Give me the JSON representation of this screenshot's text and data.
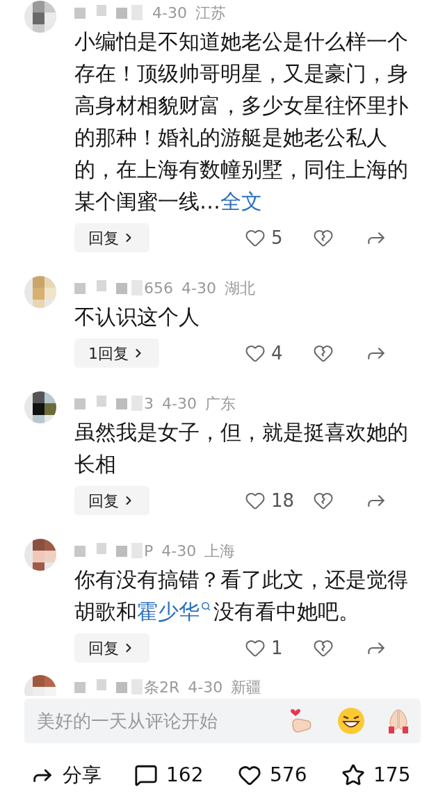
{
  "comments": [
    {
      "date": "4-30",
      "location": "江苏",
      "body": [
        {
          "kind": "text",
          "text": "小编怕是不知道她老公是什么样一个存在！顶级帅哥明星，又是豪门，身高身材相貌财富，多少女星往怀里扑的那种！婚礼的游艇是她老公私人的，在上海有数幢别墅，同住上海的某个闺蜜一线…"
        },
        {
          "kind": "link",
          "text": "全文"
        }
      ],
      "reply": "回复",
      "likes": "5"
    },
    {
      "name_tail": "656",
      "date": "4-30",
      "location": "湖北",
      "body": [
        {
          "kind": "text",
          "text": "不认识这个人"
        }
      ],
      "reply": "1回复",
      "likes": "4"
    },
    {
      "name_tail": "3",
      "date": "4-30",
      "location": "广东",
      "body": [
        {
          "kind": "text",
          "text": "虽然我是女子，但，就是挺喜欢她的长相"
        }
      ],
      "reply": "回复",
      "likes": "18"
    },
    {
      "name_tail": "P",
      "date": "4-30",
      "location": "上海",
      "body": [
        {
          "kind": "text",
          "text": "你有没有搞错？看了此文，还是觉得胡歌和"
        },
        {
          "kind": "search_link",
          "text": "霍少华"
        },
        {
          "kind": "text",
          "text": "没有看中她吧。"
        }
      ],
      "reply": "回复",
      "likes": "1"
    }
  ],
  "partial_comment": {
    "name_tail": "条2R",
    "date": "4-30",
    "location": "新疆"
  },
  "comment_input": {
    "placeholder": "美好的一天从评论开始"
  },
  "bottom_bar": [
    {
      "kind": "share",
      "label": "分享"
    },
    {
      "kind": "comment",
      "label": "162"
    },
    {
      "kind": "like",
      "label": "576"
    },
    {
      "kind": "star",
      "label": "175"
    }
  ]
}
